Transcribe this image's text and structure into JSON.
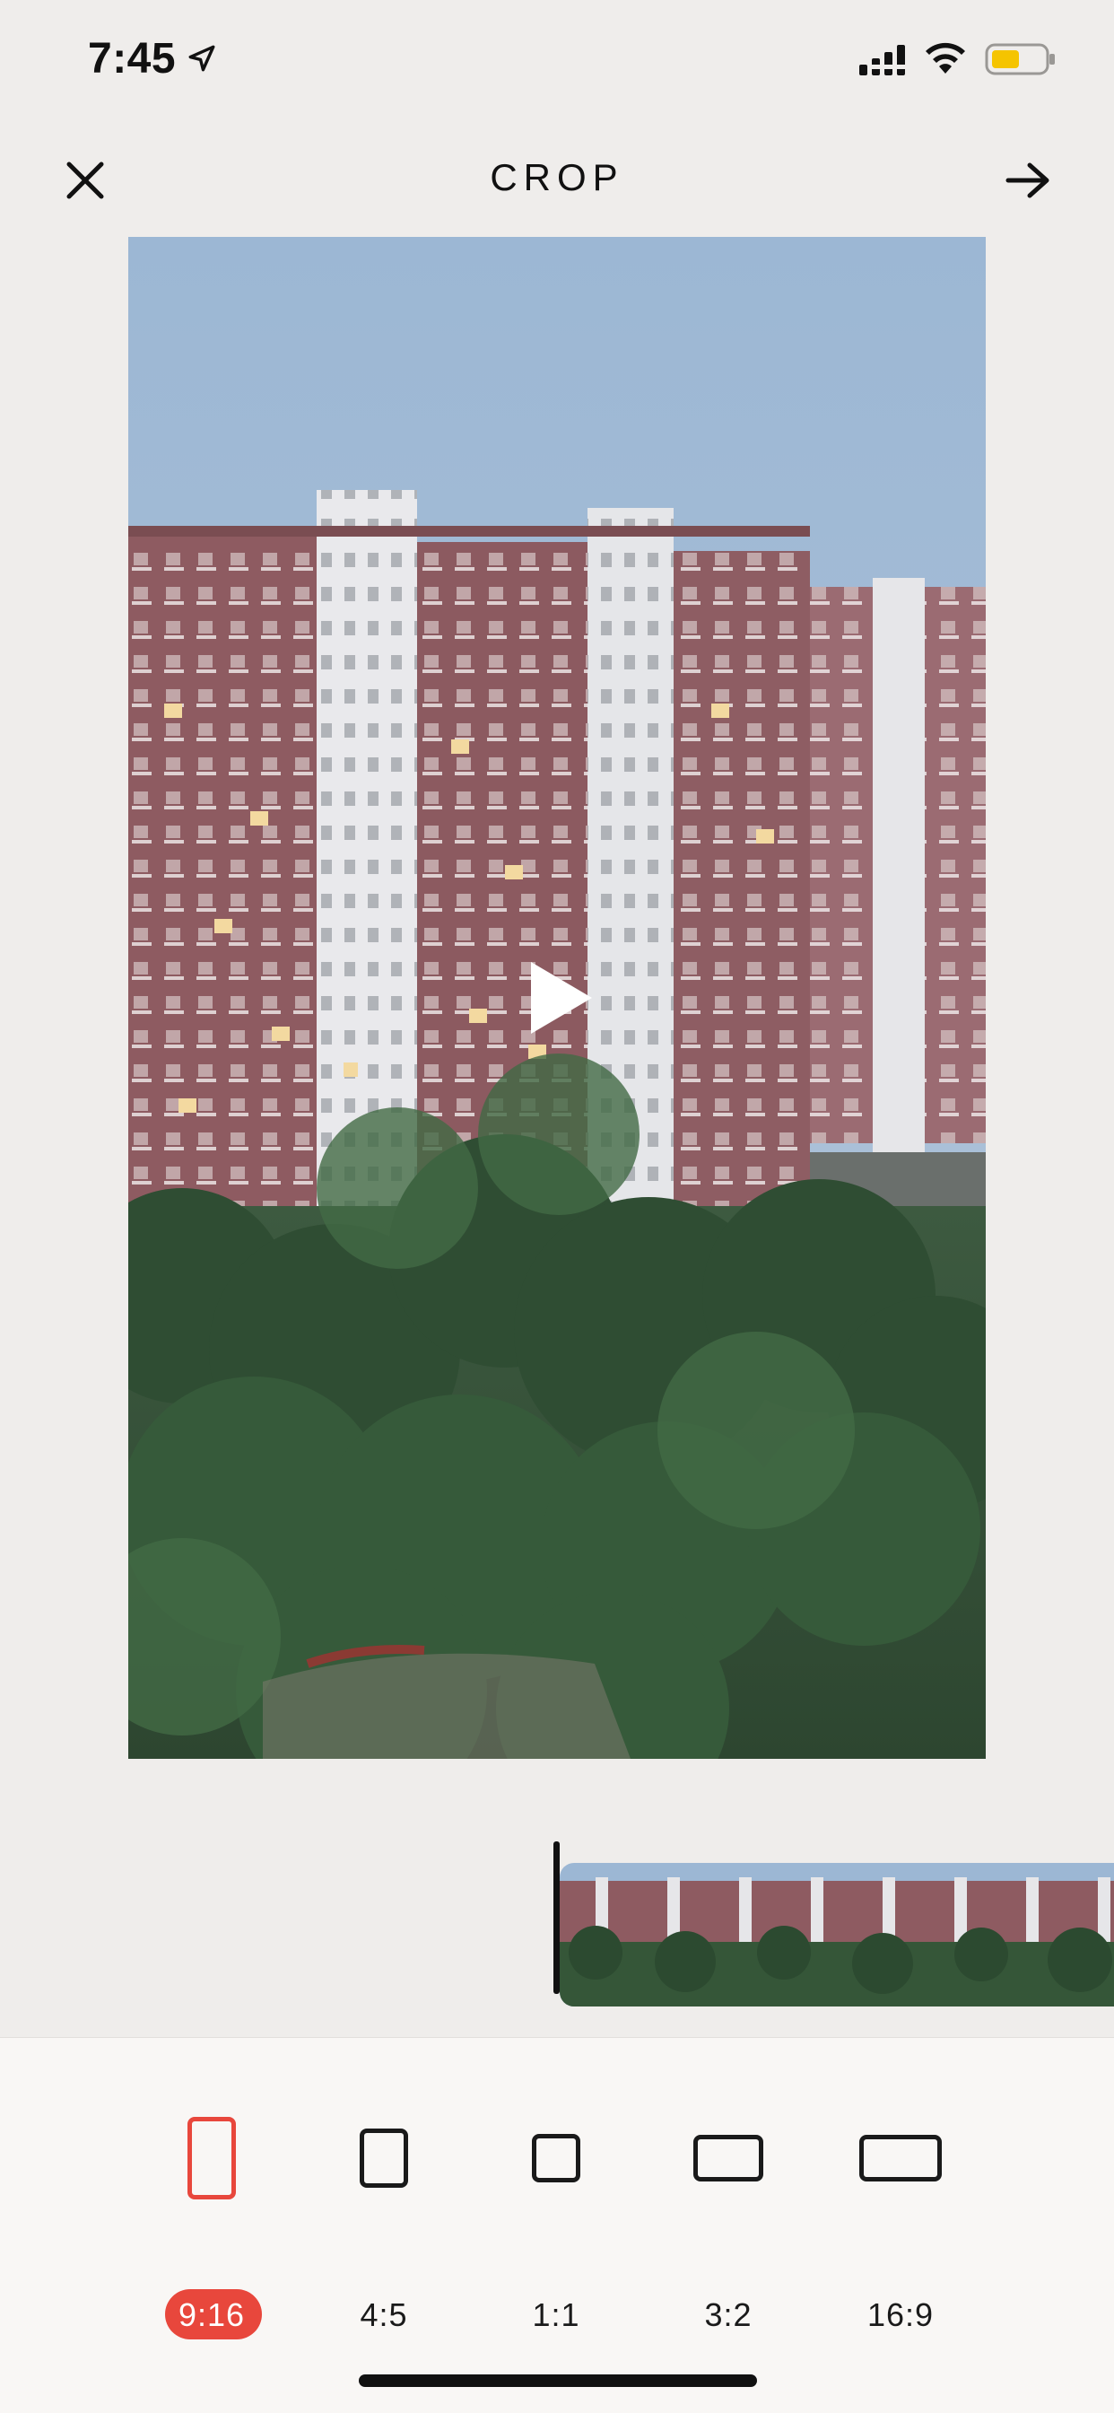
{
  "status_bar": {
    "time": "7:45",
    "icons": [
      "location-arrow-icon",
      "cellular-signal-icon",
      "wifi-icon",
      "battery-icon"
    ],
    "battery_color": "#f5c400"
  },
  "header": {
    "title": "CROP",
    "close_icon": "close-icon",
    "next_icon": "arrow-right-icon"
  },
  "preview": {
    "play_icon": "play-icon"
  },
  "crop_options": {
    "selected": "9:16",
    "accent_color": "#e8473c",
    "items": [
      {
        "label": "9:16"
      },
      {
        "label": "4:5"
      },
      {
        "label": "1:1"
      },
      {
        "label": "3:2"
      },
      {
        "label": "16:9"
      }
    ]
  }
}
